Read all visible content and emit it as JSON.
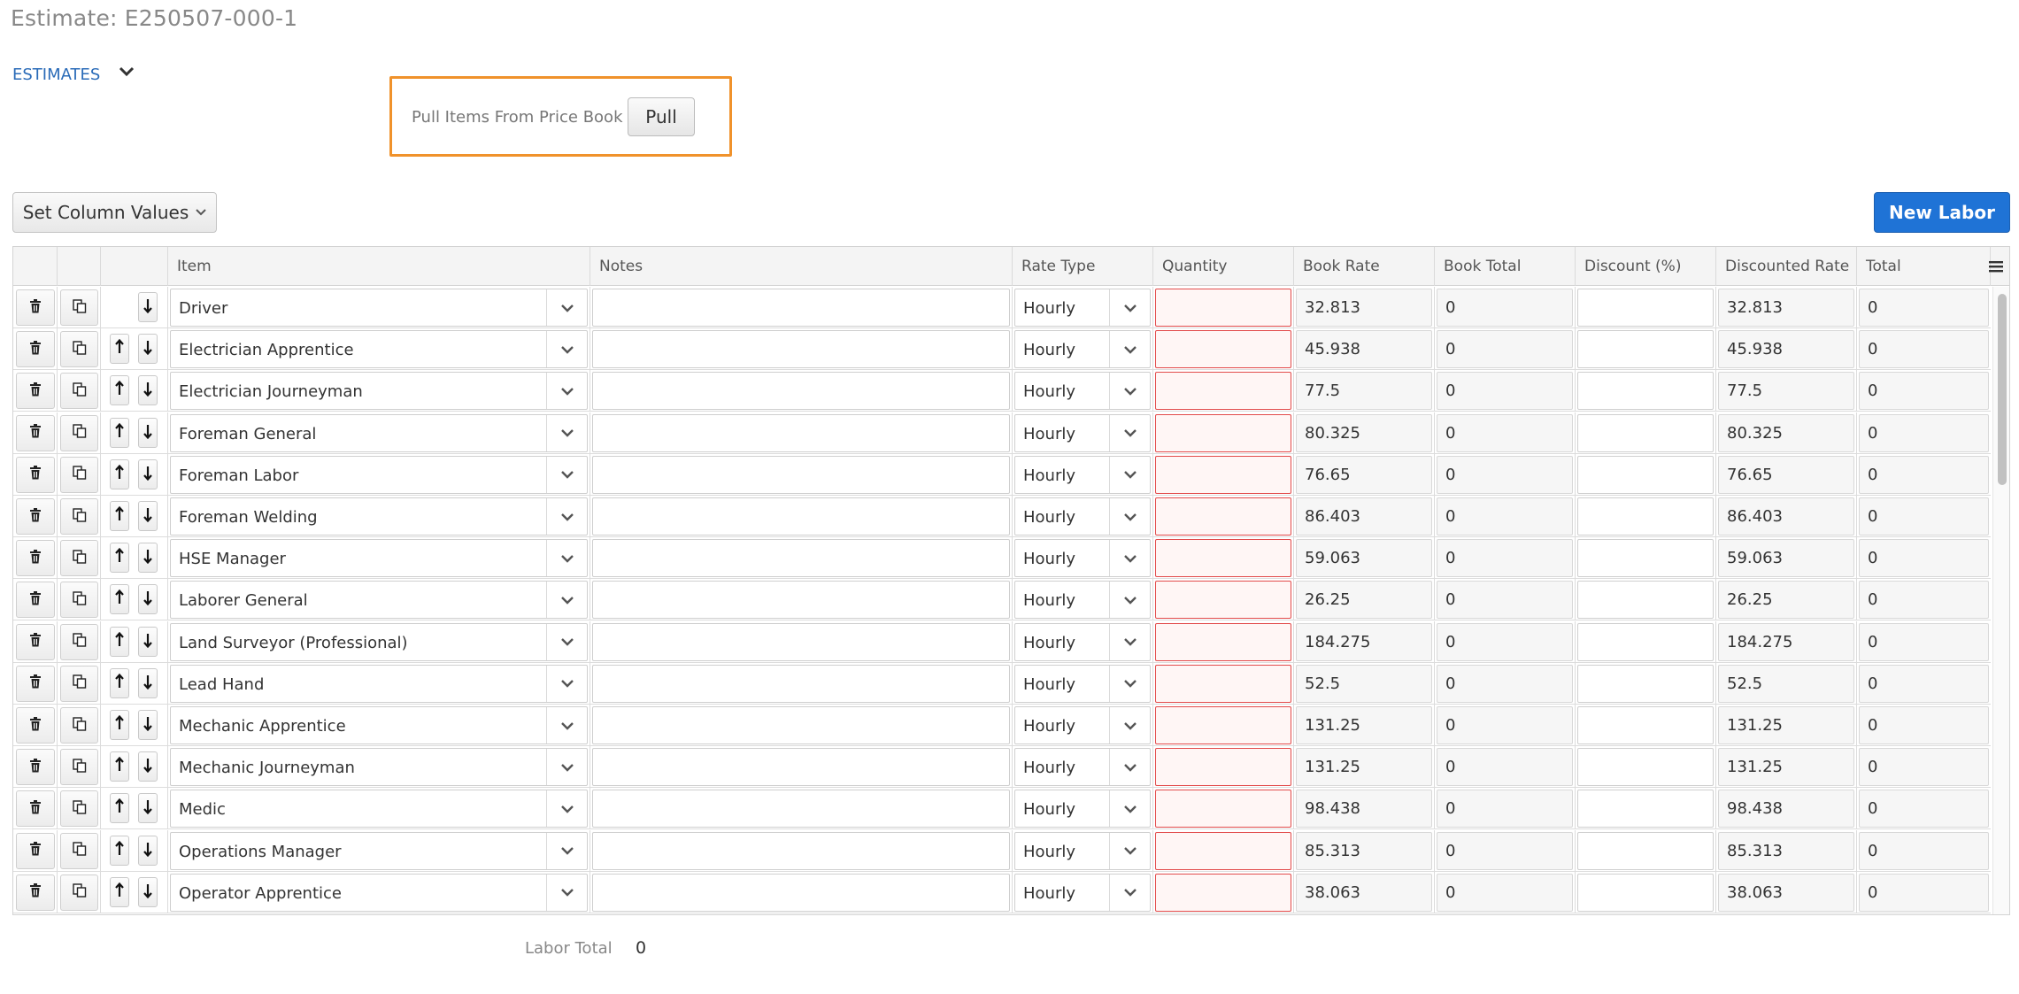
{
  "page": {
    "title": "Estimate: E250507-000-1",
    "tab_label": "ESTIMATES"
  },
  "pull": {
    "label": "Pull Items From Price Book",
    "button": "Pull"
  },
  "toolbar": {
    "set_column_values": "Set Column Values",
    "new_labor": "New Labor"
  },
  "columns": [
    "Item",
    "Notes",
    "Rate Type",
    "Quantity",
    "Book Rate",
    "Book Total",
    "Discount (%)",
    "Discounted Rate",
    "Total"
  ],
  "rows": [
    {
      "item": "Driver",
      "rate_type": "Hourly",
      "book_rate": "32.813",
      "book_total": "0",
      "discounted_rate": "32.813",
      "total": "0"
    },
    {
      "item": "Electrician Apprentice",
      "rate_type": "Hourly",
      "book_rate": "45.938",
      "book_total": "0",
      "discounted_rate": "45.938",
      "total": "0"
    },
    {
      "item": "Electrician Journeyman",
      "rate_type": "Hourly",
      "book_rate": "77.5",
      "book_total": "0",
      "discounted_rate": "77.5",
      "total": "0"
    },
    {
      "item": "Foreman General",
      "rate_type": "Hourly",
      "book_rate": "80.325",
      "book_total": "0",
      "discounted_rate": "80.325",
      "total": "0"
    },
    {
      "item": "Foreman Labor",
      "rate_type": "Hourly",
      "book_rate": "76.65",
      "book_total": "0",
      "discounted_rate": "76.65",
      "total": "0"
    },
    {
      "item": "Foreman Welding",
      "rate_type": "Hourly",
      "book_rate": "86.403",
      "book_total": "0",
      "discounted_rate": "86.403",
      "total": "0"
    },
    {
      "item": "HSE Manager",
      "rate_type": "Hourly",
      "book_rate": "59.063",
      "book_total": "0",
      "discounted_rate": "59.063",
      "total": "0"
    },
    {
      "item": "Laborer General",
      "rate_type": "Hourly",
      "book_rate": "26.25",
      "book_total": "0",
      "discounted_rate": "26.25",
      "total": "0"
    },
    {
      "item": "Land Surveyor (Professional)",
      "rate_type": "Hourly",
      "book_rate": "184.275",
      "book_total": "0",
      "discounted_rate": "184.275",
      "total": "0"
    },
    {
      "item": "Lead Hand",
      "rate_type": "Hourly",
      "book_rate": "52.5",
      "book_total": "0",
      "discounted_rate": "52.5",
      "total": "0"
    },
    {
      "item": "Mechanic Apprentice",
      "rate_type": "Hourly",
      "book_rate": "131.25",
      "book_total": "0",
      "discounted_rate": "131.25",
      "total": "0"
    },
    {
      "item": "Mechanic Journeyman",
      "rate_type": "Hourly",
      "book_rate": "131.25",
      "book_total": "0",
      "discounted_rate": "131.25",
      "total": "0"
    },
    {
      "item": "Medic",
      "rate_type": "Hourly",
      "book_rate": "98.438",
      "book_total": "0",
      "discounted_rate": "98.438",
      "total": "0"
    },
    {
      "item": "Operations Manager",
      "rate_type": "Hourly",
      "book_rate": "85.313",
      "book_total": "0",
      "discounted_rate": "85.313",
      "total": "0"
    },
    {
      "item": "Operator Apprentice",
      "rate_type": "Hourly",
      "book_rate": "38.063",
      "book_total": "0",
      "discounted_rate": "38.063",
      "total": "0"
    }
  ],
  "footer": {
    "labor_total_label": "Labor Total",
    "labor_total_value": "0"
  },
  "colors": {
    "accent_blue": "#1f73d6",
    "link_blue": "#2a6bb8",
    "highlight_orange": "#f0922b",
    "required_red": "#e24b4b"
  }
}
